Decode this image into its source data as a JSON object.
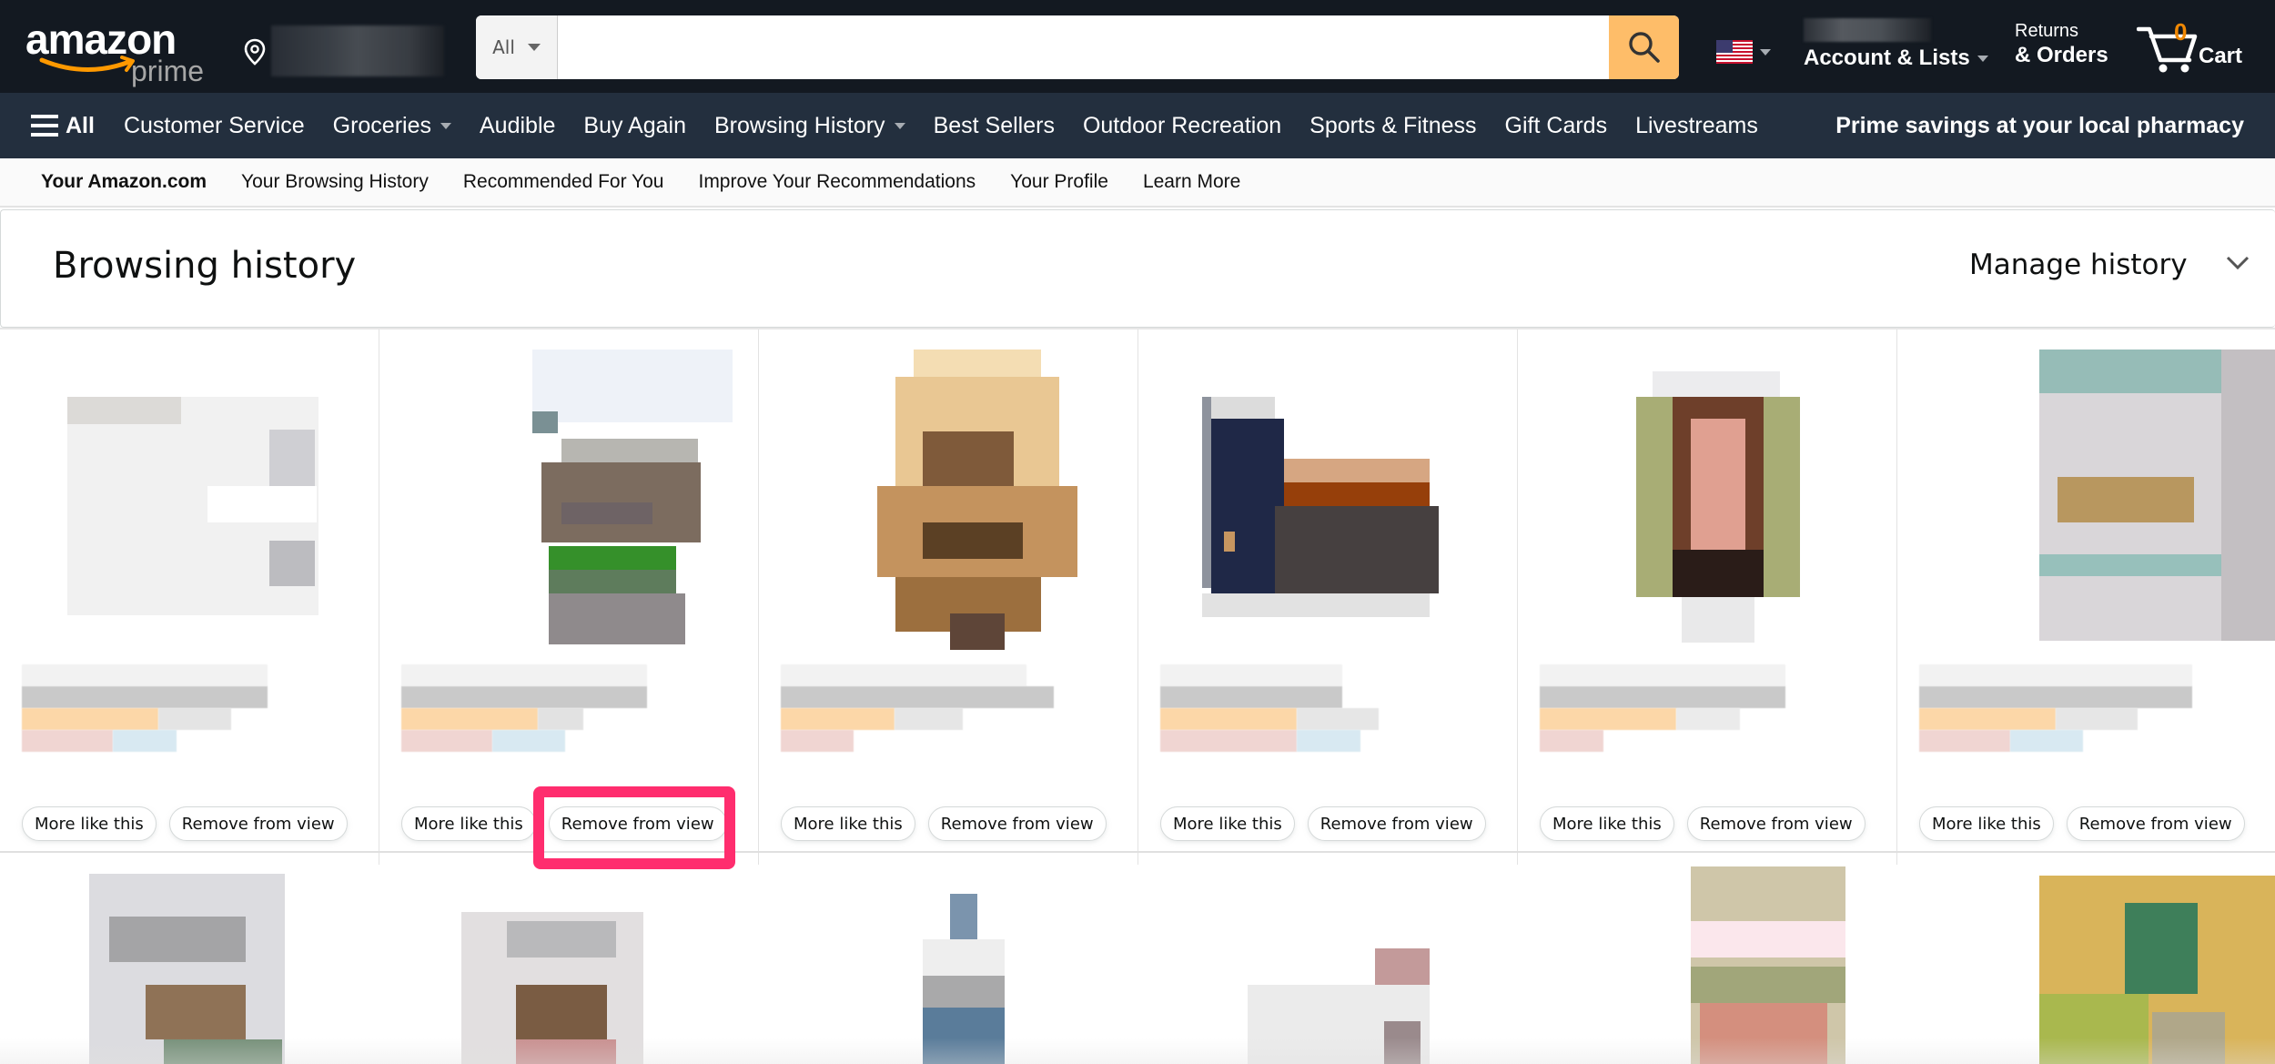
{
  "topbar": {
    "logo_text": "amazon",
    "logo_sub": "prime",
    "search": {
      "department": "All",
      "placeholder": "",
      "value": ""
    },
    "account_line2": "Account & Lists",
    "returns_line1": "Returns",
    "returns_line2": "& Orders",
    "cart_count": "0",
    "cart_label": "Cart"
  },
  "navbar": {
    "all_label": "All",
    "items": [
      {
        "label": "Customer Service",
        "dropdown": false
      },
      {
        "label": "Groceries",
        "dropdown": true
      },
      {
        "label": "Audible",
        "dropdown": false
      },
      {
        "label": "Buy Again",
        "dropdown": false
      },
      {
        "label": "Browsing History",
        "dropdown": true
      },
      {
        "label": "Best Sellers",
        "dropdown": false
      },
      {
        "label": "Outdoor Recreation",
        "dropdown": false
      },
      {
        "label": "Sports & Fitness",
        "dropdown": false
      },
      {
        "label": "Gift Cards",
        "dropdown": false
      },
      {
        "label": "Livestreams",
        "dropdown": false
      }
    ],
    "promo": "Prime savings at your local pharmacy"
  },
  "subnav": {
    "items": [
      "Your Amazon.com",
      "Your Browsing History",
      "Recommended For You",
      "Improve Your Recommendations",
      "Your Profile",
      "Learn More"
    ]
  },
  "header": {
    "title": "Browsing history",
    "manage_label": "Manage history"
  },
  "tiles": {
    "more_like_this": "More like this",
    "remove_from_view": "Remove from view",
    "count_visible_row1": 6,
    "highlighted_tile_index": 1,
    "highlighted_button": "Remove from view"
  },
  "colors": {
    "topbar_bg": "#131921",
    "navbar_bg": "#232f3e",
    "search_button": "#febd69",
    "cart_count": "#f08804",
    "highlight": "#ff2d6e"
  }
}
